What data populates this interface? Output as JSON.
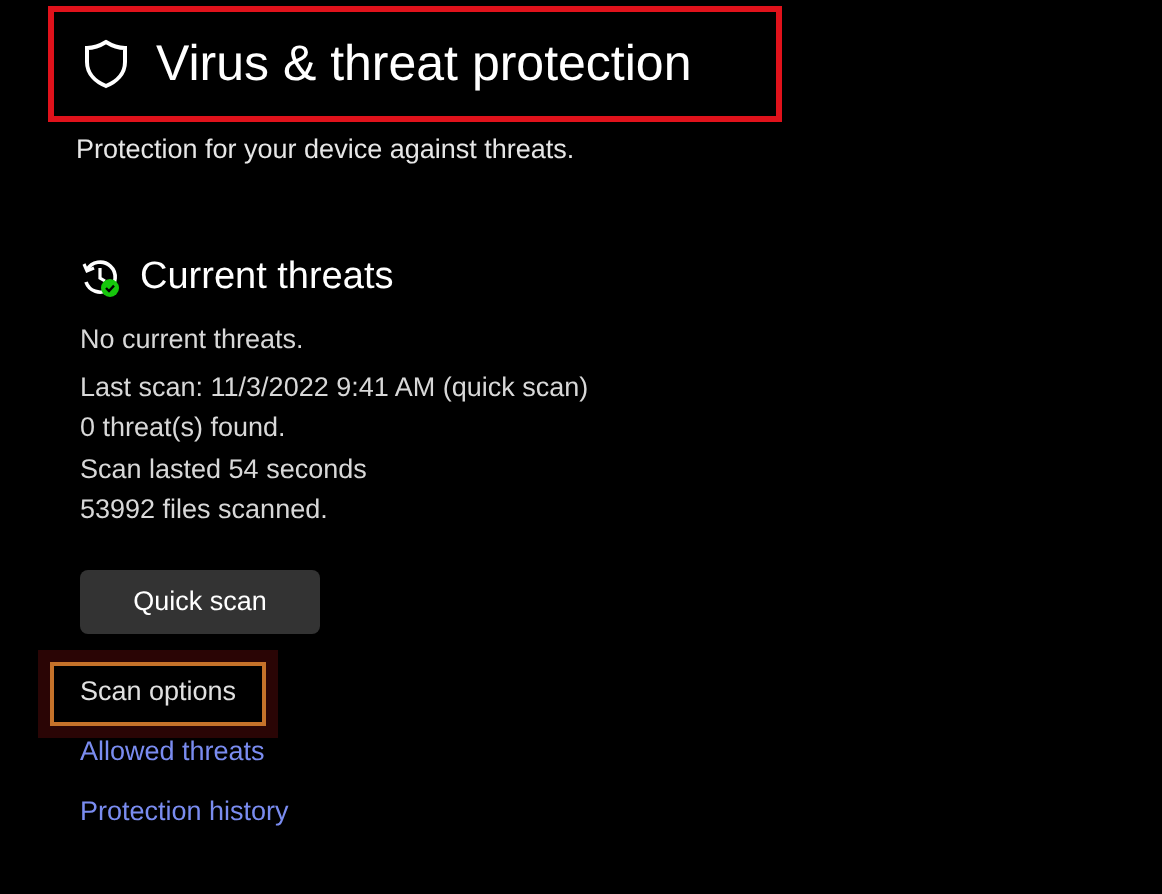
{
  "header": {
    "title": "Virus & threat protection",
    "highlighted": true,
    "subtitle": "Protection for your device against threats."
  },
  "current_threats": {
    "heading": "Current threats",
    "lines": [
      "No current threats.",
      "Last scan: 11/3/2022 9:41 AM (quick scan)",
      "0 threat(s) found.",
      "Scan lasted 54 seconds",
      "53992 files scanned."
    ],
    "button": "Quick scan"
  },
  "links": [
    {
      "label": "Scan options",
      "highlighted": true
    },
    {
      "label": "Allowed threats",
      "highlighted": false
    },
    {
      "label": "Protection history",
      "highlighted": false
    }
  ]
}
